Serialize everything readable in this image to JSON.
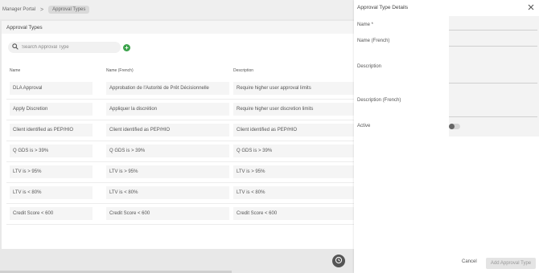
{
  "breadcrumb": {
    "root": "Manager Portal",
    "separator": ">",
    "current": "Approval Types"
  },
  "card": {
    "title": "Approval Types",
    "search_placeholder": "Search Approval Type",
    "add_label": "+"
  },
  "columns": [
    "Name",
    "Name (French)",
    "Description"
  ],
  "rows": [
    {
      "name": "DLA Approval",
      "name_fr": "Approbation de l'Autorité de Prêt Décisionnelle",
      "description": "Require higher user approval limits"
    },
    {
      "name": "Apply Discretion",
      "name_fr": "Appliquer la discrétion",
      "description": "Require higher user discretion limits"
    },
    {
      "name": "Client identified as PEP/HIO",
      "name_fr": "Client identified as PEP/HIO",
      "description": "Client identified as PEP/HIO"
    },
    {
      "name": "Q GDS is > 39%",
      "name_fr": "Q GDS is > 39%",
      "description": "Q GDS is > 39%"
    },
    {
      "name": "LTV is > 95%",
      "name_fr": "LTV is > 95%",
      "description": "LTV is > 95%"
    },
    {
      "name": "LTV is < 80%",
      "name_fr": "LTV is < 80%",
      "description": "LTV is < 80%"
    },
    {
      "name": "Credit Score < 600",
      "name_fr": "Credit Score < 600",
      "description": "Credit Score < 600"
    }
  ],
  "panel": {
    "title": "Approval Type Details",
    "labels": {
      "name": "Name *",
      "name_fr": "Name (French)",
      "description": "Description",
      "description_fr": "Description (French)",
      "active": "Active"
    },
    "values": {
      "name": "",
      "name_fr": "",
      "description": "",
      "description_fr": ""
    },
    "active": false,
    "cancel_label": "Cancel",
    "submit_label": "Add Approval Type"
  },
  "colors": {
    "accent_green": "#3aa24a",
    "panel_bg": "#ffffff",
    "field_bg": "#f3f3f3"
  },
  "icons": {
    "search": "search-icon",
    "add": "plus-circle-icon",
    "close": "close-icon",
    "history": "history-icon"
  }
}
